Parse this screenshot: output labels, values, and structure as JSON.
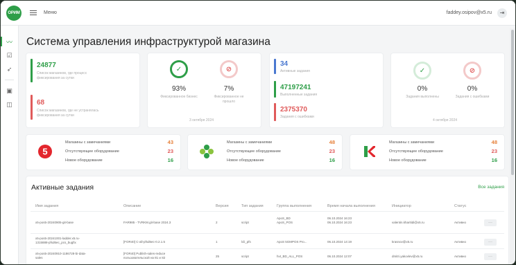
{
  "header": {
    "logo_text": "ОРИМ",
    "menu_label": "Меню",
    "user_email": "faddey.osipov@x5.ru"
  },
  "nav": {
    "icons": [
      "trend-icon",
      "checklist-icon",
      "rocket-icon",
      "id-card-icon",
      "chat-icon"
    ]
  },
  "page_title": "Система управления инфраструктурой магазина",
  "stats_card_1": {
    "items": [
      {
        "value": "24877",
        "color": "#2e9e48",
        "caption": "Список магазинов, где процесс фиксирования за сутки"
      },
      {
        "value": "68",
        "color": "#e05a5a",
        "caption": "Список магазинов, где не устранялась фиксирования за сутки"
      }
    ]
  },
  "stats_card_2": {
    "left": {
      "percent": "93%",
      "caption": "Фиксированное бизнес",
      "color": "#2e9e48",
      "symbol": "✓"
    },
    "right": {
      "percent": "7%",
      "caption": "Фиксированное не прошло",
      "color": "#e05a5a",
      "symbol": "⊘"
    },
    "date": "3 октября 2024"
  },
  "stats_card_3": {
    "items": [
      {
        "value": "34",
        "color": "#4a78d0",
        "caption": "Активные задания"
      },
      {
        "value": "47197241",
        "color": "#2e9e48",
        "caption": "Выполненные задания"
      },
      {
        "value": "2375370",
        "color": "#e05a5a",
        "caption": "Задания с ошибками"
      }
    ]
  },
  "stats_card_4": {
    "left": {
      "percent": "0%",
      "caption": "Задания выполнены",
      "color": "#2e9e48",
      "symbol": "✓"
    },
    "right": {
      "percent": "0%",
      "caption": "Задания с ошибками",
      "color": "#e05a5a",
      "symbol": "⊘"
    },
    "date": "4 октября 2024"
  },
  "stores": [
    {
      "brand": "five",
      "rows": [
        {
          "label": "Магазины с замечаниями",
          "value": "43",
          "color": "#e6803a"
        },
        {
          "label": "Отсутствующее оборудование",
          "value": "23",
          "color": "#e05a5a"
        },
        {
          "label": "Новое оборудование",
          "value": "16",
          "color": "#2e9e48"
        }
      ]
    },
    {
      "brand": "perekrestok",
      "rows": [
        {
          "label": "Магазины с замечаниями",
          "value": "48",
          "color": "#e6803a"
        },
        {
          "label": "Отсутствующее оборудование",
          "value": "23",
          "color": "#e05a5a"
        },
        {
          "label": "Новое оборудование",
          "value": "16",
          "color": "#2e9e48"
        }
      ]
    },
    {
      "brand": "karusel",
      "rows": [
        {
          "label": "Магазины с замечаниями",
          "value": "48",
          "color": "#e6803a"
        },
        {
          "label": "Отсутствующее оборудование",
          "value": "23",
          "color": "#e05a5a"
        },
        {
          "label": "Новое оборудование",
          "value": "16",
          "color": "#2e9e48"
        }
      ]
    }
  ],
  "tasks": {
    "title": "Активные задания",
    "all_link": "Все задания",
    "columns": [
      "Имя задания",
      "Описание",
      "Версия",
      "Тип задания",
      "Группа выполнения",
      "Время начала выполнения",
      "Инициатор",
      "Статус"
    ],
    "rows": [
      {
        "name": "x5-pos5-20240905-git-base",
        "desc": "FAR985 - TVRKM.git-base 2024.3",
        "version": "2",
        "type": "script",
        "group": "ApoS_BD\nApoS_POS",
        "time": "06.10.2024 16:23\n06.10.2024 16:23",
        "initiator": "valentin.kharitidi@x5.ru",
        "status": "Активно"
      },
      {
        "name": "x5-pos5-20241001-ladder.x5.ru-\n1315888-pfsd6ec_pcs_bugfix",
        "desc": "[FOR40] C-all-pfsd6ec-0.2.1.5",
        "version": "1",
        "type": "lcli_pfs",
        "group": "ApoS 5GMPOS Pro...",
        "time": "06.10.2024 14:19",
        "initiator": "krasnov@x5.ru",
        "status": "Активно"
      },
      {
        "name": "x5-pos5-20240910-1186728-bi-data-\nsales",
        "desc": "[FOR40] Publish-sales-reduce\nпользовательской на 81 и 82",
        "version": "25",
        "type": "script",
        "group": "hvt_BD_ALL_POS",
        "time": "06.10.2024 12:07",
        "initiator": "dmitri.yakovlev@x5.ru",
        "status": "Активно"
      }
    ]
  }
}
